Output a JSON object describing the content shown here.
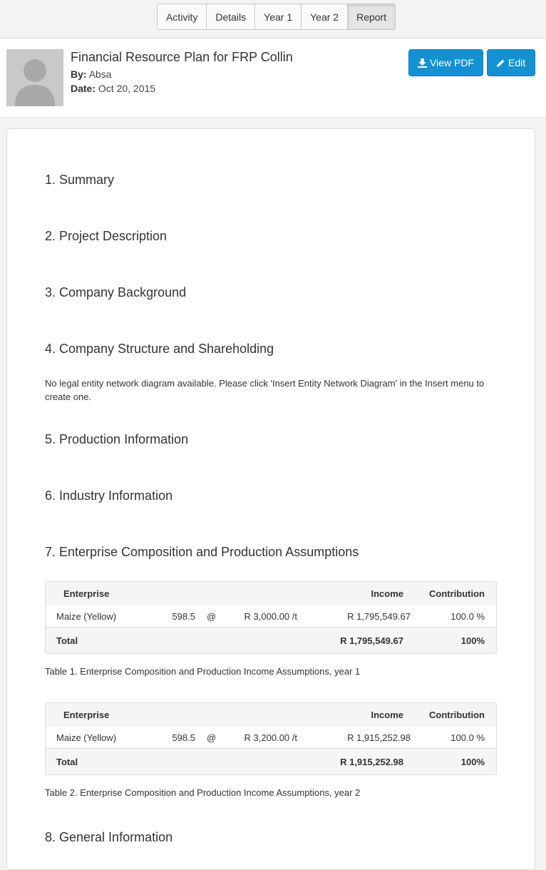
{
  "tabs": [
    "Activity",
    "Details",
    "Year 1",
    "Year 2",
    "Report"
  ],
  "active_tab": "Report",
  "header": {
    "title": "Financial Resource Plan for FRP Collin",
    "by_label": "By:",
    "by_value": "Absa",
    "date_label": "Date:",
    "date_value": "Oct 20, 2015",
    "view_pdf": "View PDF",
    "edit": "Edit"
  },
  "sections": [
    "1. Summary",
    "2. Project Description",
    "3. Company Background",
    "4. Company Structure and Shareholding",
    "5. Production Information",
    "6. Industry Information",
    "7. Enterprise Composition and Production Assumptions",
    "8. General Information"
  ],
  "section4_text": "No legal entity network diagram available. Please click 'Insert Entity Network Diagram' in the Insert menu to create one.",
  "tables": [
    {
      "headers": {
        "enterprise": "Enterprise",
        "income": "Income",
        "contribution": "Contribution"
      },
      "row": {
        "name": "Maize (Yellow)",
        "qty": "598.5",
        "at": "@",
        "price": "R 3,000.00 /t",
        "income": "R 1,795,549.67",
        "contribution": "100.0 %"
      },
      "total": {
        "label": "Total",
        "income": "R 1,795,549.67",
        "contribution": "100%"
      },
      "caption": "Table 1. Enterprise Composition and Production Income Assumptions, year 1"
    },
    {
      "headers": {
        "enterprise": "Enterprise",
        "income": "Income",
        "contribution": "Contribution"
      },
      "row": {
        "name": "Maize (Yellow)",
        "qty": "598.5",
        "at": "@",
        "price": "R 3,200.00 /t",
        "income": "R 1,915,252.98",
        "contribution": "100.0 %"
      },
      "total": {
        "label": "Total",
        "income": "R 1,915,252.98",
        "contribution": "100%"
      },
      "caption": "Table 2. Enterprise Composition and Production Income Assumptions, year 2"
    }
  ]
}
